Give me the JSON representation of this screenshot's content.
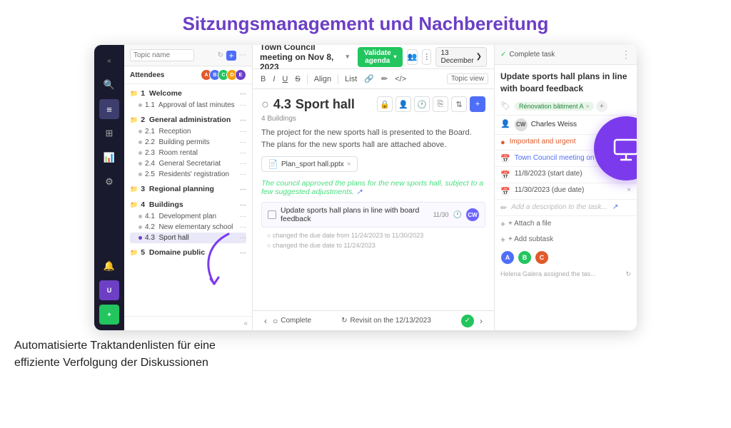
{
  "page": {
    "title": "Sitzungsmanagement und Nachbereitung",
    "bottom_text_line1": "Automatisierte Traktandenlisten für eine",
    "bottom_text_line2": "effiziente Verfolgung der Diskussionen"
  },
  "topbar": {
    "meeting_title": "Town Council meeting on Nov 8, 2023",
    "chevron": "▾",
    "validate_btn": "Validate agenda",
    "date_btn": "13 December",
    "date_arrow": "❯"
  },
  "toolbar": {
    "bold": "B",
    "italic": "I",
    "underline": "U",
    "strikethrough": "S",
    "align": "Align",
    "list": "List",
    "topic_view": "Topic view"
  },
  "topic": {
    "number": "4.3",
    "name": "Sport hall",
    "section": "4 Buildings",
    "description": "The project for the new sports hall is presented to the Board. The plans for the new sports hall are attached above.",
    "file_name": "Plan_sport hall.pptx",
    "suggestion": "The council approved the plans for the new sports hall, subject to a few suggested adjustments.",
    "task_text": "Update sports hall plans in line with board feedback",
    "task_progress": "11/30",
    "change1": "changed the due date from 11/24/2023 to 11/30/2023",
    "change2": "changed the due date to 11/24/2023"
  },
  "bottom_bar": {
    "complete": "Complete",
    "revisit": "Revisit on the 12/13/2023"
  },
  "right_panel": {
    "complete_task": "Complete task",
    "task_title": "Update sports hall plans in line with board feedback",
    "tag": "Rénovation bâtiment A",
    "person": "Charles Weiss",
    "priority": "Important and urgent",
    "meeting_link": "Town Council meeting on ...",
    "start_date": "11/8/2023  (start date)",
    "due_date": "11/30/2023  (due date)",
    "desc_placeholder": "Add a description to the task...",
    "attach": "+ Attach a file",
    "subtask": "+ Add subtask",
    "activity": "Helena Galera assigned the tas..."
  },
  "agenda": {
    "attendees_label": "Attendees",
    "items": [
      {
        "id": "1",
        "label": "Welcome",
        "level": 1
      },
      {
        "id": "1.1",
        "label": "1.1  Approval of last minutes",
        "level": 2
      },
      {
        "id": "2",
        "label": "2  General administration",
        "level": 1
      },
      {
        "id": "2.1",
        "label": "2.1  Reception",
        "level": 2
      },
      {
        "id": "2.2",
        "label": "2.2  Building permits",
        "level": 2
      },
      {
        "id": "2.3",
        "label": "2.3  Room rental",
        "level": 2
      },
      {
        "id": "2.4",
        "label": "2.4  General Secretariat",
        "level": 2
      },
      {
        "id": "2.5",
        "label": "2.5  Residents' registration",
        "level": 2
      },
      {
        "id": "3",
        "label": "3  Regional planning",
        "level": 1
      },
      {
        "id": "4",
        "label": "4  Buildings",
        "level": 1
      },
      {
        "id": "4.1",
        "label": "4.1  Development plan",
        "level": 2
      },
      {
        "id": "4.2",
        "label": "4.2  New elementary school",
        "level": 2
      },
      {
        "id": "4.3",
        "label": "4.3  Sport hall",
        "level": 2,
        "active": true
      },
      {
        "id": "5",
        "label": "5  Domaine public",
        "level": 1
      }
    ]
  }
}
